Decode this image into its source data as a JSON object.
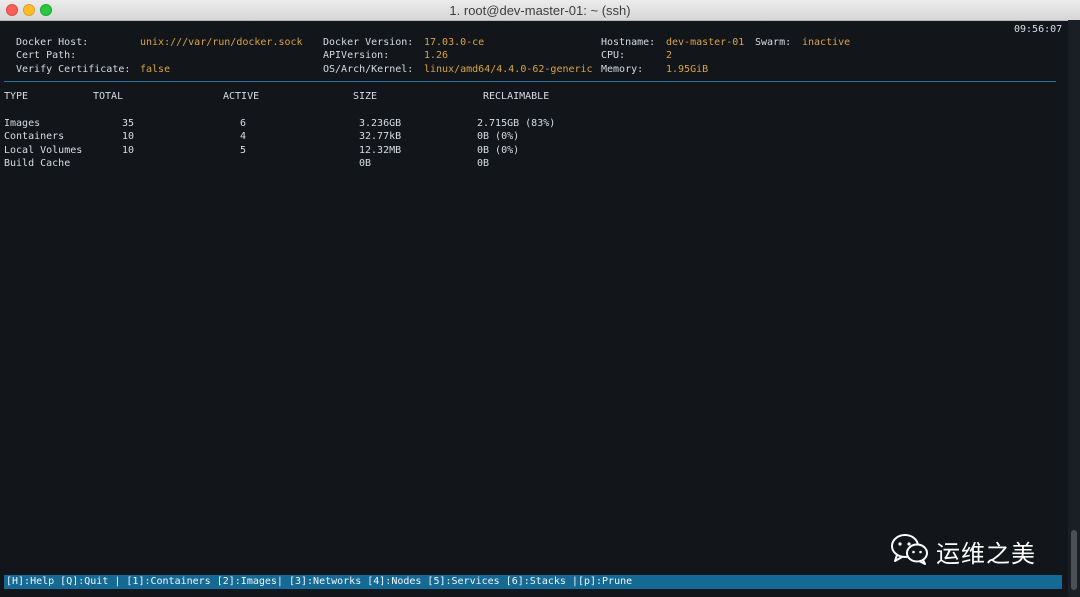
{
  "window": {
    "title": "1. root@dev-master-01: ~ (ssh)"
  },
  "clock": "09:56:07",
  "info": {
    "docker_host_label": "Docker Host:",
    "docker_host_value": "unix:///var/run/docker.sock",
    "cert_path_label": "Cert Path:",
    "verify_label": "Verify Certificate:",
    "verify_value": "false",
    "docker_version_label": "Docker Version:",
    "docker_version_value": "17.03.0-ce",
    "api_label": "APIVersion:",
    "api_value": "1.26",
    "os_label": "OS/Arch/Kernel:",
    "os_value": "linux/amd64/4.4.0-62-generic",
    "hostname_label": "Hostname:",
    "hostname_value": "dev-master-01",
    "swarm_label": "Swarm:",
    "swarm_value": "inactive",
    "cpu_label": "CPU:",
    "cpu_value": "2",
    "memory_label": "Memory:",
    "memory_value": "1.95GiB"
  },
  "table": {
    "headers": [
      "TYPE",
      "TOTAL",
      "ACTIVE",
      "SIZE",
      "RECLAIMABLE"
    ],
    "rows": [
      [
        "Images",
        "35",
        "6",
        "3.236GB",
        "2.715GB (83%)"
      ],
      [
        "Containers",
        "10",
        "4",
        "32.77kB",
        "0B (0%)"
      ],
      [
        "Local Volumes",
        "10",
        "5",
        "12.32MB",
        "0B (0%)"
      ],
      [
        "Build Cache",
        "",
        "",
        "0B",
        "0B"
      ]
    ]
  },
  "footer": "[H]:Help [Q]:Quit | [1]:Containers [2]:Images| [3]:Networks [4]:Nodes [5]:Services [6]:Stacks |[p]:Prune",
  "watermark": "运维之美",
  "colors": {
    "value": "#d9a441",
    "footer_bg": "#156a95",
    "divider": "#2f6f9e",
    "background": "#12161b"
  }
}
